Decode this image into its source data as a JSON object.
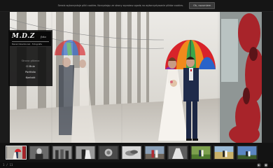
{
  "cookie_bar": {
    "text": "Serwis wykorzystuje pliki cookies. Korzystając ze strony wyrażasz zgodę na wykorzystywanie plików cookies.",
    "ok_label": "Ok, rozumiem"
  },
  "logo": {
    "main": "M.D.Z",
    "sub_word": "foto",
    "tagline": "Marek Dziemborek · Fotografia"
  },
  "nav": {
    "items": [
      {
        "label": "Strona główna",
        "active": true
      },
      {
        "label": "O Mnie",
        "active": false
      },
      {
        "label": "Portfolio",
        "active": false
      },
      {
        "label": "Kontakt",
        "active": false
      }
    ]
  },
  "gallery": {
    "counter": "1 / 11",
    "thumbnails": [
      {
        "name": "thumb-1",
        "scene": "couple-umbrella",
        "active": true
      },
      {
        "name": "thumb-2",
        "scene": "bw-portrait",
        "active": false
      },
      {
        "name": "thumb-3",
        "scene": "bw-group",
        "active": false
      },
      {
        "name": "thumb-4",
        "scene": "bw-couple",
        "active": false
      },
      {
        "name": "thumb-5",
        "scene": "bw-detail",
        "active": false
      },
      {
        "name": "thumb-6",
        "scene": "bw-hands",
        "active": false
      },
      {
        "name": "thumb-7",
        "scene": "color-street",
        "active": false
      },
      {
        "name": "thumb-8",
        "scene": "bw-dress",
        "active": false
      },
      {
        "name": "thumb-9",
        "scene": "green-park",
        "active": false
      },
      {
        "name": "thumb-10",
        "scene": "color-field",
        "active": false
      },
      {
        "name": "thumb-11",
        "scene": "color-sky",
        "active": false
      }
    ]
  },
  "controls": {
    "play_icon": "play-icon",
    "fullscreen_icon": "fullscreen-icon"
  },
  "colors": {
    "background": "#1b1b1b",
    "umbrella_red": "#d8232a",
    "umbrella_green": "#3aa64a",
    "umbrella_blue": "#2a63c9",
    "ivy_red": "#a8242a"
  }
}
